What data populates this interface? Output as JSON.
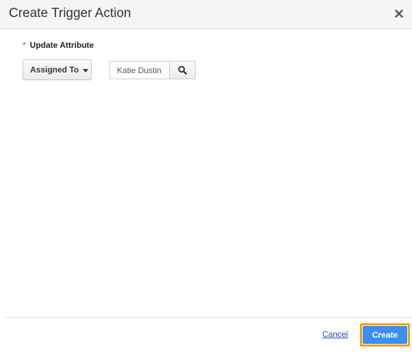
{
  "dialog": {
    "title": "Create Trigger Action"
  },
  "form": {
    "required_marker": "*",
    "field_label": "Update Attribute",
    "attribute_dropdown": {
      "selected": "Assigned To"
    },
    "value_input": {
      "value": "Katie Dustin"
    }
  },
  "footer": {
    "cancel_label": "Cancel",
    "create_label": "Create"
  },
  "icons": {
    "close": "close-icon",
    "dropdown": "chevron-down-icon",
    "search": "search-icon"
  },
  "colors": {
    "primary_button": "#3b8ff0",
    "highlight_border": "#f39c12",
    "required": "#d9262b",
    "link": "#1a3fb3"
  }
}
